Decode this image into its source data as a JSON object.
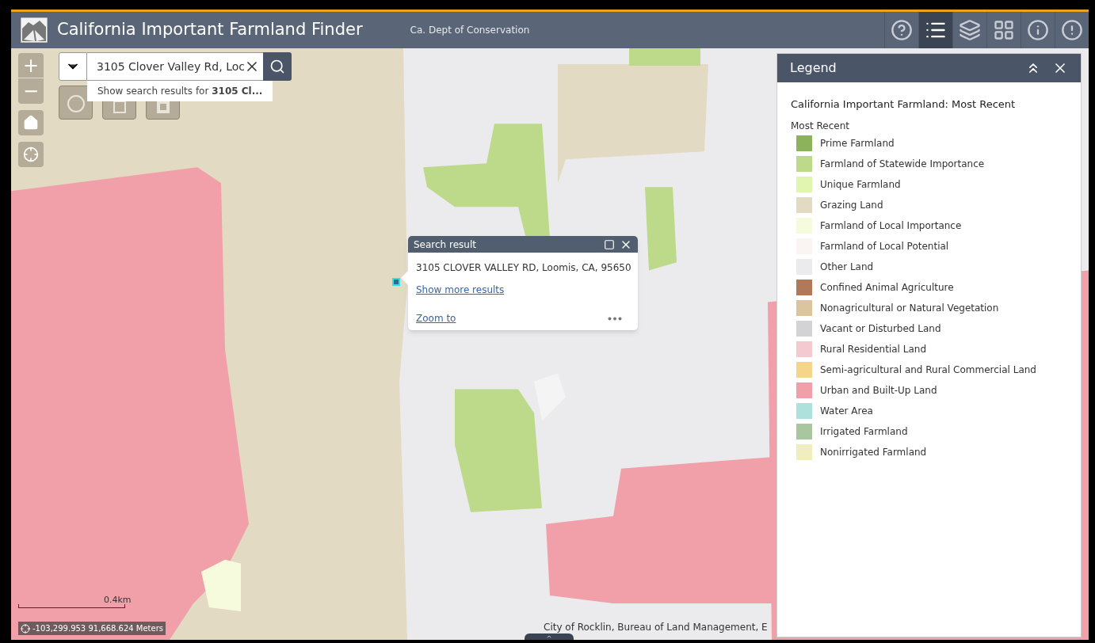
{
  "header": {
    "title": "California Important Farmland Finder",
    "subtitle": "Ca. Dept of Conservation",
    "tools": [
      {
        "kind": "help",
        "selected": false
      },
      {
        "kind": "legend",
        "selected": true
      },
      {
        "kind": "layers",
        "selected": false
      },
      {
        "kind": "grid",
        "selected": false
      },
      {
        "kind": "info",
        "selected": false
      },
      {
        "kind": "alert",
        "selected": false
      }
    ]
  },
  "map_controls": {
    "zoom_in": "+",
    "zoom_out": "−"
  },
  "search": {
    "value": "3105 Clover Valley Rd, Loc",
    "suggestion": "Show search results for **3105 Cl...**"
  },
  "draw_tools": [
    {
      "kind": "circle"
    },
    {
      "kind": "square"
    },
    {
      "kind": "square-bold"
    }
  ],
  "popup": {
    "title": "Search result",
    "address": "3105 CLOVER VALLEY RD, Loomis, CA, 95650",
    "more_link": "Show more results",
    "zoom_link": "Zoom to"
  },
  "legend": {
    "title": "Legend",
    "layer_title": "California Important Farmland: Most Recent",
    "group": "Most Recent",
    "items": [
      {
        "label": "Prime Farmland",
        "color": "#8db35a"
      },
      {
        "label": "Farmland of Statewide Importance",
        "color": "#bdd98a"
      },
      {
        "label": "Unique Farmland",
        "color": "#e2f5b0"
      },
      {
        "label": "Grazing Land",
        "color": "#e3dac4"
      },
      {
        "label": "Farmland of Local Importance",
        "color": "#f7fbdd"
      },
      {
        "label": "Farmland of Local Potential",
        "color": "#faf4f2"
      },
      {
        "label": "Other Land",
        "color": "#ebebed"
      },
      {
        "label": "Confined Animal Agriculture",
        "color": "#b07a5a"
      },
      {
        "label": "Nonagricultural or Natural Vegetation",
        "color": "#dcc59e"
      },
      {
        "label": "Vacant or Disturbed Land",
        "color": "#d3d3d5"
      },
      {
        "label": "Rural Residential Land",
        "color": "#f4c9cf"
      },
      {
        "label": "Semi-agricultural and Rural Commercial Land",
        "color": "#f5d58a"
      },
      {
        "label": "Urban and Built-Up Land",
        "color": "#f19fa8"
      },
      {
        "label": "Water Area",
        "color": "#aee0dc"
      },
      {
        "label": "Irrigated Farmland",
        "color": "#a9c79f"
      },
      {
        "label": "Nonirrigated Farmland",
        "color": "#f0edc0"
      }
    ]
  },
  "scale": "0.4km",
  "coordinates": "-103,299.953 91,668.624 Meters",
  "attribution": "City of Rocklin, Bureau of Land Management, E"
}
